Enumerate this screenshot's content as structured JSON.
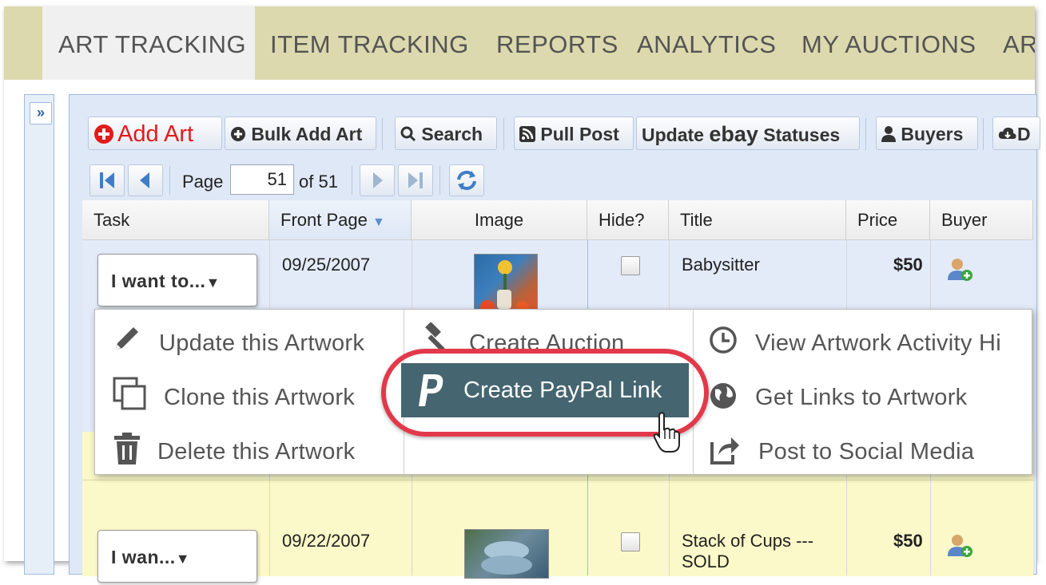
{
  "nav": {
    "tabs": [
      "ART TRACKING",
      "ITEM TRACKING",
      "REPORTS",
      "ANALYTICS",
      "MY AUCTIONS",
      "AR"
    ]
  },
  "toolbar": {
    "add_art": "Add Art",
    "bulk_add_art": "Bulk Add Art",
    "search": "Search",
    "pull_post": "Pull Post",
    "update_statuses_prefix": "Update ",
    "update_statuses_brand": "ebay",
    "update_statuses_suffix": " Statuses",
    "buyers": "Buyers",
    "more": "D"
  },
  "pager": {
    "page_label": "Page",
    "page_value": "51",
    "of_label": "of 51"
  },
  "grid": {
    "columns": [
      "Task",
      "Front Page",
      "Image",
      "Hide?",
      "Title",
      "Price",
      "Buyer"
    ],
    "rows": [
      {
        "task": "I want to...",
        "front_page": "09/25/2007",
        "title": "Babysitter",
        "price": "$50"
      },
      {
        "task": "I wan",
        "task_suffix": "...",
        "front_page": "09/22/2007",
        "title": "Stack of Cups ---",
        "title2": "SOLD",
        "price": "$50"
      }
    ]
  },
  "menu": {
    "col1": [
      "Update this Artwork",
      "Clone this Artwork",
      "Delete this Artwork"
    ],
    "col2": [
      "Create Auction",
      "Create PayPal Link"
    ],
    "col3": [
      "View Artwork Activity Hi",
      "Get Links to Artwork",
      "Post to Social Media"
    ]
  },
  "colors": {
    "nav_bg": "#dcd9ae",
    "highlight": "#456570",
    "callout": "#e2394a",
    "add_art": "#e21b1b"
  }
}
